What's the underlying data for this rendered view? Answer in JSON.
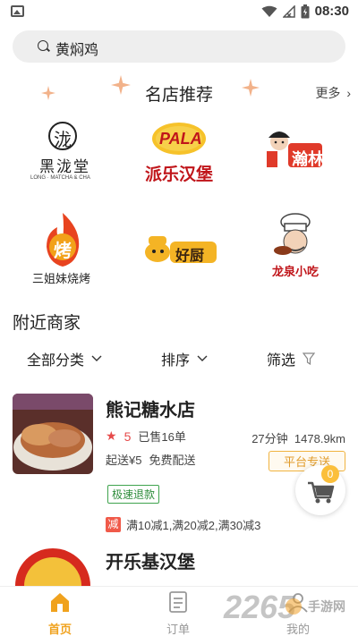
{
  "status_bar": {
    "time": "08:30"
  },
  "search": {
    "query": "黄焖鸡"
  },
  "recommend": {
    "title": "名店推荐",
    "more": "更多"
  },
  "shops_grid": [
    {
      "name": "黑泷堂",
      "logo_text": "泷",
      "sub": "LONG · MATCHA & CHA"
    },
    {
      "name": "派乐汉堡",
      "logo_text": "PALA"
    },
    {
      "name": "瀚林",
      "logo_text": "瀚林"
    },
    {
      "name": "三姐妹烧烤",
      "logo_text": "烤"
    },
    {
      "name": "好厨",
      "logo_text": "好厨"
    },
    {
      "name": "龙泉小吃",
      "logo_text": "龙泉小吃"
    }
  ],
  "nearby": {
    "title": "附近商家"
  },
  "filters": {
    "category": "全部分类",
    "sort": "排序",
    "filter": "筛选"
  },
  "merchants": [
    {
      "name": "熊记糖水店",
      "rating": "5",
      "sold": "已售16单",
      "time": "27分钟",
      "distance": "1478.9km",
      "delivery": "起送¥5",
      "free_delivery": "免费配送",
      "platform_tag": "平台专送",
      "fast_refund": "极速退款",
      "promo_badge": "减",
      "promo": "满10减1,满20减2,满30减3"
    },
    {
      "name": "开乐基汉堡",
      "rating": "",
      "sold": "",
      "time": "",
      "distance": ""
    }
  ],
  "cart": {
    "count": "0"
  },
  "tabs": [
    {
      "label": "首页",
      "active": true
    },
    {
      "label": "订单",
      "active": false
    },
    {
      "label": "我的",
      "active": false
    }
  ],
  "watermark": {
    "brand": "2265",
    "site": "手游网"
  },
  "colors": {
    "accent": "#f0a21e",
    "rating": "#e64a4a",
    "fast_refund": "#2f8d3c",
    "promo": "#f05a4a"
  }
}
